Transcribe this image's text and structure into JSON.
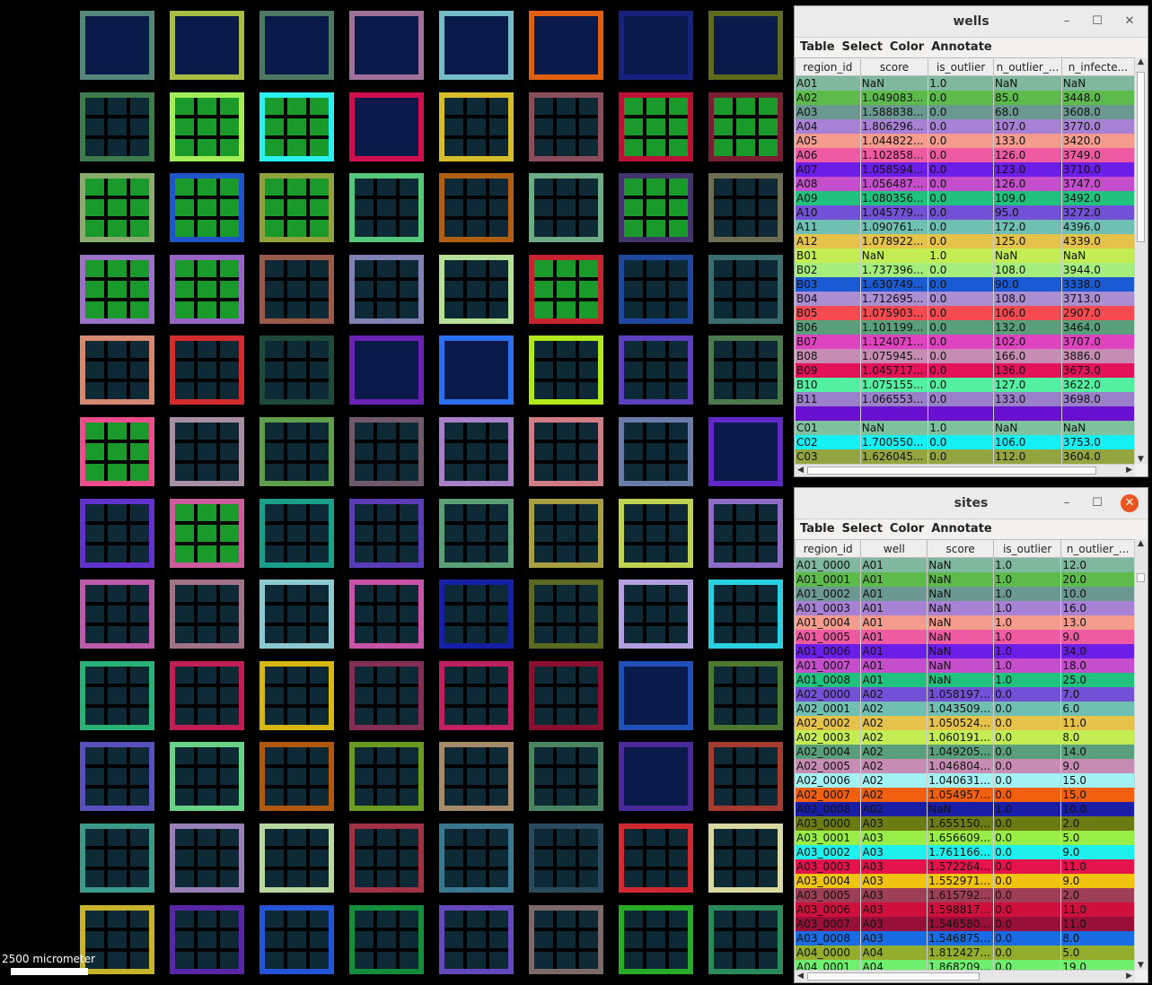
{
  "scalebar": {
    "label": "2500 micrometer"
  },
  "plate": {
    "well_colors": [
      [
        "#52877a",
        "#a8bd43",
        "#4d7862",
        "#a0719a",
        "#76bcc8",
        "#e0600f",
        "#16227d",
        "#5e6a1c"
      ],
      [
        "#3e7c4e",
        "#a2ed58",
        "#2af0f0",
        "#d0104e",
        "#d6be2a",
        "#8a4e5a",
        "#bd1035",
        "#7a1e32"
      ],
      [
        "#8aac6c",
        "#1f55c8",
        "#90a23a",
        "#56c87c",
        "#b06010",
        "#6eac88",
        "#43346e",
        "#6e6e52"
      ],
      [
        "#9c72c8",
        "#9864c6",
        "#9a5a48",
        "#8082b6",
        "#b4e098",
        "#c82430",
        "#1f48a0",
        "#3a6e6e"
      ],
      [
        "#d68870",
        "#d42c2e",
        "#1e4a3c",
        "#6a22b4",
        "#2a70f0",
        "#b0e81c",
        "#5c40c0",
        "#4c7a4c"
      ],
      [
        "#ee4c8c",
        "#a890a4",
        "#5e9e4c",
        "#6e5a68",
        "#a880c8",
        "#d07c86",
        "#6a7ca8",
        "#6028c8"
      ],
      [
        "#6232cc",
        "#cc5c9c",
        "#1aa08a",
        "#5a3cb6",
        "#5ca078",
        "#a8a040",
        "#c0d050",
        "#8e6cc6"
      ],
      [
        "#bb5caa",
        "#a07486",
        "#8ccad0",
        "#c854a8",
        "#1420a6",
        "#5a6a22",
        "#b4a0e0",
        "#28d0e0"
      ],
      [
        "#2ab276",
        "#c01e54",
        "#d8b810",
        "#842e56",
        "#c02060",
        "#8a1030",
        "#1e50b8",
        "#4c7a30"
      ],
      [
        "#5850bc",
        "#6ad286",
        "#b0580c",
        "#6a9a20",
        "#a68a6a",
        "#4a8460",
        "#4a2a9a",
        "#a63c30"
      ],
      [
        "#3c9a8a",
        "#9a80b8",
        "#b8d8a0",
        "#a03244",
        "#3a7890",
        "#2a4a5e",
        "#d02a30",
        "#d8d8a0"
      ],
      [
        "#c8b42a",
        "#5a26a8",
        "#2454d8",
        "#148e3a",
        "#6648be",
        "#7c6a6a",
        "#28ac28",
        "#2a8a5a"
      ]
    ],
    "well_intensity": [
      [
        1,
        1,
        1,
        1,
        1,
        1,
        1,
        1
      ],
      [
        2,
        3,
        3,
        1,
        2,
        2,
        3,
        3
      ],
      [
        3,
        3,
        3,
        2,
        2,
        2,
        3,
        2
      ],
      [
        3,
        3,
        2,
        2,
        2,
        3,
        2,
        2
      ],
      [
        2,
        2,
        2,
        1,
        1,
        2,
        2,
        2
      ],
      [
        3,
        2,
        2,
        2,
        2,
        2,
        2,
        1
      ],
      [
        2,
        3,
        2,
        2,
        2,
        2,
        2,
        2
      ],
      [
        2,
        2,
        2,
        2,
        2,
        2,
        2,
        2
      ],
      [
        2,
        2,
        2,
        2,
        2,
        2,
        1,
        2
      ],
      [
        2,
        2,
        2,
        2,
        2,
        2,
        1,
        2
      ],
      [
        2,
        2,
        2,
        2,
        2,
        2,
        2,
        2
      ],
      [
        2,
        2,
        2,
        2,
        2,
        2,
        2,
        2
      ]
    ]
  },
  "wells_window": {
    "title": "wells",
    "menus": [
      "Table",
      "Select",
      "Color",
      "Annotate"
    ],
    "columns": [
      "region_id",
      "score",
      "is_outlier",
      "n_outlier_...",
      "n_infecte..."
    ],
    "rows": [
      {
        "c": [
          "A01",
          "NaN",
          "1.0",
          "NaN",
          "NaN"
        ],
        "bg": "#7fb89e"
      },
      {
        "c": [
          "A02",
          "1.049083...",
          "0.0",
          "85.0",
          "3448.0"
        ],
        "bg": "#5cbb4a"
      },
      {
        "c": [
          "A03",
          "1.588838...",
          "0.0",
          "68.0",
          "3608.0"
        ],
        "bg": "#6b9891"
      },
      {
        "c": [
          "A04",
          "1.806296...",
          "0.0",
          "107.0",
          "3770.0"
        ],
        "bg": "#a781d3"
      },
      {
        "c": [
          "A05",
          "1.044822...",
          "0.0",
          "133.0",
          "3420.0"
        ],
        "bg": "#f59b8e"
      },
      {
        "c": [
          "A06",
          "1.102858...",
          "0.0",
          "126.0",
          "3749.0"
        ],
        "bg": "#ef5ba3"
      },
      {
        "c": [
          "A07",
          "1.058594...",
          "0.0",
          "123.0",
          "3710.0"
        ],
        "bg": "#6b1ee8"
      },
      {
        "c": [
          "A08",
          "1.056487...",
          "0.0",
          "126.0",
          "3747.0"
        ],
        "bg": "#c44ecb"
      },
      {
        "c": [
          "A09",
          "1.080356...",
          "0.0",
          "109.0",
          "3492.0"
        ],
        "bg": "#21c27e"
      },
      {
        "c": [
          "A10",
          "1.045779...",
          "0.0",
          "95.0",
          "3272.0"
        ],
        "bg": "#7251d6"
      },
      {
        "c": [
          "A11",
          "1.090761...",
          "0.0",
          "172.0",
          "4396.0"
        ],
        "bg": "#6fbfb3"
      },
      {
        "c": [
          "A12",
          "1.078922...",
          "0.0",
          "125.0",
          "4339.0"
        ],
        "bg": "#e5c24a"
      },
      {
        "c": [
          "B01",
          "NaN",
          "1.0",
          "NaN",
          "NaN"
        ],
        "bg": "#c3ed53"
      },
      {
        "c": [
          "B02",
          "1.737396...",
          "0.0",
          "108.0",
          "3944.0"
        ],
        "bg": "#a3ee7d"
      },
      {
        "c": [
          "B03",
          "1.630749...",
          "0.0",
          "90.0",
          "3338.0"
        ],
        "bg": "#1a5bd4"
      },
      {
        "c": [
          "B04",
          "1.712695...",
          "0.0",
          "108.0",
          "3713.0"
        ],
        "bg": "#ab8dd1"
      },
      {
        "c": [
          "B05",
          "1.075903...",
          "0.0",
          "106.0",
          "2907.0"
        ],
        "bg": "#f44a50"
      },
      {
        "c": [
          "B06",
          "1.101199...",
          "0.0",
          "132.0",
          "3464.0"
        ],
        "bg": "#5a9f7b"
      },
      {
        "c": [
          "B07",
          "1.124071...",
          "0.0",
          "102.0",
          "3707.0"
        ],
        "bg": "#e043c0"
      },
      {
        "c": [
          "B08",
          "1.075945...",
          "0.0",
          "166.0",
          "3886.0"
        ],
        "bg": "#c78cb3"
      },
      {
        "c": [
          "B09",
          "1.045717...",
          "0.0",
          "136.0",
          "3673.0"
        ],
        "bg": "#e31259"
      },
      {
        "c": [
          "B10",
          "1.075155...",
          "0.0",
          "127.0",
          "3622.0"
        ],
        "bg": "#53f0a2"
      },
      {
        "c": [
          "B11",
          "1.066553...",
          "0.0",
          "133.0",
          "3698.0"
        ],
        "bg": "#9a80c8"
      },
      {
        "c": [
          "",
          "",
          "",
          "",
          ""
        ],
        "bg": "#6a10d0"
      },
      {
        "c": [
          "C01",
          "NaN",
          "1.0",
          "NaN",
          "NaN"
        ],
        "bg": "#7ec19e"
      },
      {
        "c": [
          "C02",
          "1.700550...",
          "0.0",
          "106.0",
          "3753.0"
        ],
        "bg": "#15f0f4"
      },
      {
        "c": [
          "C03",
          "1.626045...",
          "0.0",
          "112.0",
          "3604.0"
        ],
        "bg": "#94a43f"
      }
    ]
  },
  "sites_window": {
    "title": "sites",
    "menus": [
      "Table",
      "Select",
      "Color",
      "Annotate"
    ],
    "columns": [
      "region_id",
      "well",
      "score",
      "is_outlier",
      "n_outlier_..."
    ],
    "rows": [
      {
        "c": [
          "A01_0000",
          "A01",
          "NaN",
          "1.0",
          "12.0"
        ],
        "bg": "#7fb89e"
      },
      {
        "c": [
          "A01_0001",
          "A01",
          "NaN",
          "1.0",
          "20.0"
        ],
        "bg": "#5cbb4a"
      },
      {
        "c": [
          "A01_0002",
          "A01",
          "NaN",
          "1.0",
          "10.0"
        ],
        "bg": "#6b9891"
      },
      {
        "c": [
          "A01_0003",
          "A01",
          "NaN",
          "1.0",
          "16.0"
        ],
        "bg": "#a781d3"
      },
      {
        "c": [
          "A01_0004",
          "A01",
          "NaN",
          "1.0",
          "13.0"
        ],
        "bg": "#f59b8e"
      },
      {
        "c": [
          "A01_0005",
          "A01",
          "NaN",
          "1.0",
          "9.0"
        ],
        "bg": "#ef5ba3"
      },
      {
        "c": [
          "A01_0006",
          "A01",
          "NaN",
          "1.0",
          "34.0"
        ],
        "bg": "#6b1ee8"
      },
      {
        "c": [
          "A01_0007",
          "A01",
          "NaN",
          "1.0",
          "18.0"
        ],
        "bg": "#c44ecb"
      },
      {
        "c": [
          "A01_0008",
          "A01",
          "NaN",
          "1.0",
          "25.0"
        ],
        "bg": "#21c27e"
      },
      {
        "c": [
          "A02_0000",
          "A02",
          "1.058197...",
          "0.0",
          "7.0"
        ],
        "bg": "#7251d6"
      },
      {
        "c": [
          "A02_0001",
          "A02",
          "1.043509...",
          "0.0",
          "6.0"
        ],
        "bg": "#6fbfb3"
      },
      {
        "c": [
          "A02_0002",
          "A02",
          "1.050524...",
          "0.0",
          "11.0"
        ],
        "bg": "#e5c24a"
      },
      {
        "c": [
          "A02_0003",
          "A02",
          "1.060191...",
          "0.0",
          "8.0"
        ],
        "bg": "#c3ed53"
      },
      {
        "c": [
          "A02_0004",
          "A02",
          "1.049205...",
          "0.0",
          "14.0"
        ],
        "bg": "#5a9f7b"
      },
      {
        "c": [
          "A02_0005",
          "A02",
          "1.046804...",
          "0.0",
          "9.0"
        ],
        "bg": "#c78cb3"
      },
      {
        "c": [
          "A02_0006",
          "A02",
          "1.040631...",
          "0.0",
          "15.0"
        ],
        "bg": "#a2f2f4"
      },
      {
        "c": [
          "A02_0007",
          "A02",
          "1.054957...",
          "0.0",
          "15.0"
        ],
        "bg": "#f25f0e"
      },
      {
        "c": [
          "A02_0008",
          "A02",
          "NaN",
          "1.0",
          "10.0"
        ],
        "bg": "#1a1ea6"
      },
      {
        "c": [
          "A03_0000",
          "A03",
          "1.655150...",
          "0.0",
          "2.0"
        ],
        "bg": "#6b7c13"
      },
      {
        "c": [
          "A03_0001",
          "A03",
          "1.656609...",
          "0.0",
          "5.0"
        ],
        "bg": "#98ee46"
      },
      {
        "c": [
          "A03_0002",
          "A03",
          "1.761166...",
          "0.0",
          "9.0"
        ],
        "bg": "#1ef0ee"
      },
      {
        "c": [
          "A03_0003",
          "A03",
          "1.572264...",
          "0.0",
          "11.0"
        ],
        "bg": "#e5134c"
      },
      {
        "c": [
          "A03_0004",
          "A03",
          "1.552971...",
          "0.0",
          "9.0"
        ],
        "bg": "#f0c40e"
      },
      {
        "c": [
          "A03_0005",
          "A03",
          "1.615792...",
          "0.0",
          "2.0"
        ],
        "bg": "#9e3e58"
      },
      {
        "c": [
          "A03_0006",
          "A03",
          "1.598817...",
          "0.0",
          "11.0"
        ],
        "bg": "#d0103c"
      },
      {
        "c": [
          "A03_0007",
          "A03",
          "1.546580...",
          "0.0",
          "11.0"
        ],
        "bg": "#98103a"
      },
      {
        "c": [
          "A03_0008",
          "A03",
          "1.546875...",
          "0.0",
          "8.0"
        ],
        "bg": "#1a6ce4"
      },
      {
        "c": [
          "A04_0000",
          "A04",
          "1.812427...",
          "0.0",
          "5.0"
        ],
        "bg": "#95ad2c"
      },
      {
        "c": [
          "A04_0001",
          "A04",
          "1.868209...",
          "0.0",
          "19.0"
        ],
        "bg": "#6ef06e"
      }
    ]
  }
}
